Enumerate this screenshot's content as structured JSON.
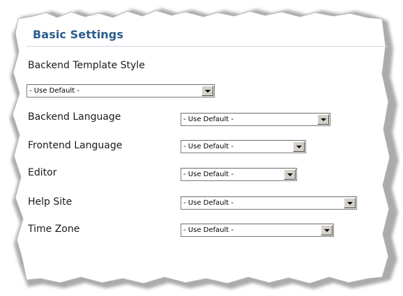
{
  "section": {
    "title": "Basic Settings"
  },
  "fields": [
    {
      "label": "Backend Template Style",
      "value": "- Use Default -"
    },
    {
      "label": "Backend Language",
      "value": "- Use Default -"
    },
    {
      "label": "Frontend Language",
      "value": "- Use Default -"
    },
    {
      "label": "Editor",
      "value": "- Use Default -"
    },
    {
      "label": "Help Site",
      "value": "- Use Default -"
    },
    {
      "label": "Time Zone",
      "value": "- Use Default -"
    }
  ],
  "colors": {
    "title": "#2a5d8a",
    "label": "#1a1a1a",
    "paper": "#ffffff",
    "edge_shadow": "#9a9a9a"
  }
}
